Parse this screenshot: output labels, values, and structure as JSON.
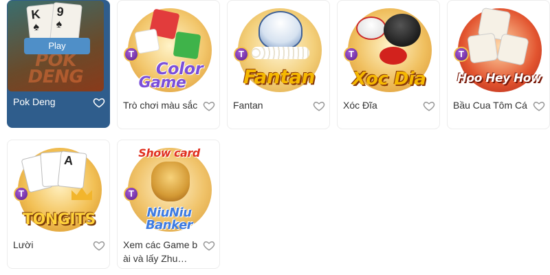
{
  "games": [
    {
      "name": "Pok Deng",
      "logo_line1": "POK",
      "logo_line2": "DENG",
      "card_rank_1": "K",
      "card_rank_2": "9",
      "play_label": "Play",
      "selected": true
    },
    {
      "name": "Trò chơi màu sắc",
      "logo_line1": "Color",
      "logo_line2": "Game",
      "badge": "T"
    },
    {
      "name": "Fantan",
      "logo_line1": "Fantan",
      "badge": "T"
    },
    {
      "name": "Xóc Đĩa",
      "logo_line1": "Xoc Dia",
      "badge": "T"
    },
    {
      "name": "Bầu Cua Tôm Cá",
      "logo_line1": "Hoo Hey How",
      "badge": "T"
    },
    {
      "name": "Lười",
      "logo_line1": "TONGITS",
      "card_rank": "A",
      "badge": "T"
    },
    {
      "name": "Xem các Game bài và lấy Zhu…",
      "logo_top": "Show card",
      "logo_line1": "NiuNiu",
      "logo_line2": "Banker",
      "badge": "T"
    }
  ],
  "colors": {
    "selected_card_bg": "#2f5d8c",
    "play_button": "#4f8fc8",
    "heart_outline": "#999999"
  },
  "icons": {
    "favorite": "heart-outline-icon",
    "provider_badge": "t-badge-icon"
  }
}
